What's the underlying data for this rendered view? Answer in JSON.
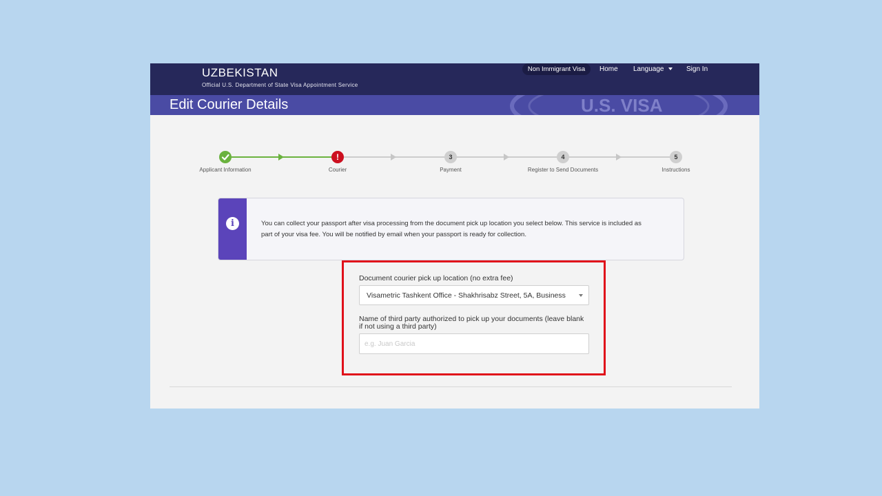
{
  "header": {
    "country": "Uzbekistan",
    "subtitle": "Official U.S. Department of State Visa Appointment Service",
    "nav": {
      "visa_type": "Non Immigrant Visa",
      "home": "Home",
      "language": "Language",
      "sign_in": "Sign In"
    },
    "page_title": "Edit Courier Details",
    "seal_text": "U.S. VISA"
  },
  "steps": [
    {
      "number": "",
      "label": "Applicant Information",
      "state": "complete"
    },
    {
      "number": "!",
      "label": "Courier",
      "state": "current"
    },
    {
      "number": "3",
      "label": "Payment",
      "state": "pending"
    },
    {
      "number": "4",
      "label": "Register to Send Documents",
      "state": "pending"
    },
    {
      "number": "5",
      "label": "Instructions",
      "state": "pending"
    }
  ],
  "info": {
    "text": "You can collect your passport after visa processing from the document pick up location you select below. This service is included as part of your visa fee. You will be notified by email when your passport is ready for collection."
  },
  "form": {
    "pickup_label": "Document courier pick up location (no extra fee)",
    "pickup_value": "Visametric Tashkent Office - Shakhrisabz Street, 5A, Business",
    "third_party_label": "Name of third party authorized to pick up your documents (leave blank if not using a third party)",
    "third_party_placeholder": "e.g. Juan Garcia",
    "third_party_value": ""
  },
  "colors": {
    "header_bg": "#26285a",
    "banner_bg": "#4a4ba4",
    "complete": "#6ab23e",
    "current": "#cc1020",
    "pending": "#cfcfcf",
    "info_accent": "#5b44ba",
    "highlight": "#e0101a"
  }
}
